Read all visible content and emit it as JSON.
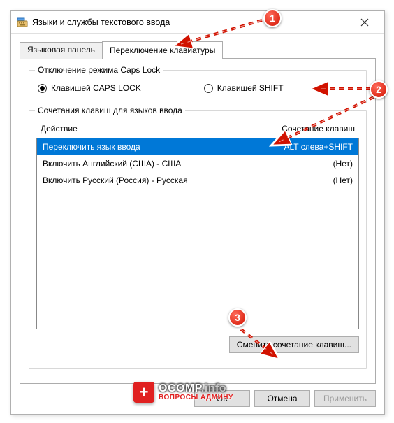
{
  "window": {
    "title": "Языки и службы текстового ввода"
  },
  "tabs": {
    "tab1": "Языковая панель",
    "tab2": "Переключение клавиатуры"
  },
  "capslock_group": {
    "legend": "Отключение режима Caps Lock",
    "option_caps": "Клавишей CAPS LOCK",
    "option_shift": "Клавишей SHIFT"
  },
  "hotkey_group": {
    "legend": "Сочетания клавиш для языков ввода",
    "col_action": "Действие",
    "col_keys": "Сочетание клавиш",
    "rows": [
      {
        "action": "Переключить язык ввода",
        "keys": "ALT слева+SHIFT",
        "selected": true
      },
      {
        "action": "Включить Английский (США) - США",
        "keys": "(Нет)",
        "selected": false
      },
      {
        "action": "Включить Русский (Россия) - Русская",
        "keys": "(Нет)",
        "selected": false
      }
    ],
    "change_button": "Сменить сочетание клавиш..."
  },
  "buttons": {
    "ok": "ОК",
    "cancel": "Отмена",
    "apply": "Применить"
  },
  "callouts": {
    "c1": "1",
    "c2": "2",
    "c3": "3"
  },
  "watermark": {
    "brand_main": "OCOMP",
    "brand_suffix": ".info",
    "tagline": "ВОПРОСЫ АДМИНУ"
  }
}
